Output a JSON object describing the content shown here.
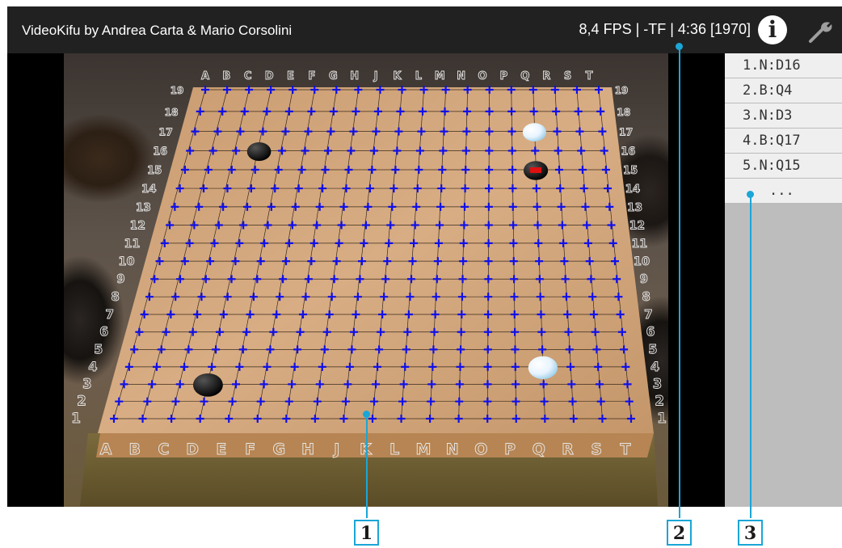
{
  "header": {
    "app_title": "VideoKifu by Andrea Carta & Mario Corsolini",
    "status": "8,4 FPS | -TF | 4:36 [1970]",
    "info_label": "i"
  },
  "board": {
    "columns": [
      "A",
      "B",
      "C",
      "D",
      "E",
      "F",
      "G",
      "H",
      "J",
      "K",
      "L",
      "M",
      "N",
      "O",
      "P",
      "Q",
      "R",
      "S",
      "T"
    ],
    "rows": [
      "1",
      "2",
      "3",
      "4",
      "5",
      "6",
      "7",
      "8",
      "9",
      "10",
      "11",
      "12",
      "13",
      "14",
      "15",
      "16",
      "17",
      "18",
      "19"
    ],
    "grid_marker_color": "#1010e8",
    "stones": [
      {
        "col": "D",
        "row": 16,
        "color": "black"
      },
      {
        "col": "Q",
        "row": 17,
        "color": "white"
      },
      {
        "col": "Q",
        "row": 15,
        "color": "black",
        "last_move": true
      },
      {
        "col": "D",
        "row": 3,
        "color": "black"
      },
      {
        "col": "Q",
        "row": 4,
        "color": "white"
      }
    ]
  },
  "moves": [
    "1.N:D16",
    "2.B:Q4",
    "3.N:D3",
    "4.B:Q17",
    "5.N:Q15",
    "..."
  ],
  "callouts": [
    "1",
    "2",
    "3"
  ],
  "colors": {
    "callout": "#1aa6d6",
    "topbar": "#212121",
    "panel": "#bdbdbd",
    "last_move_marker": "#e01010"
  }
}
